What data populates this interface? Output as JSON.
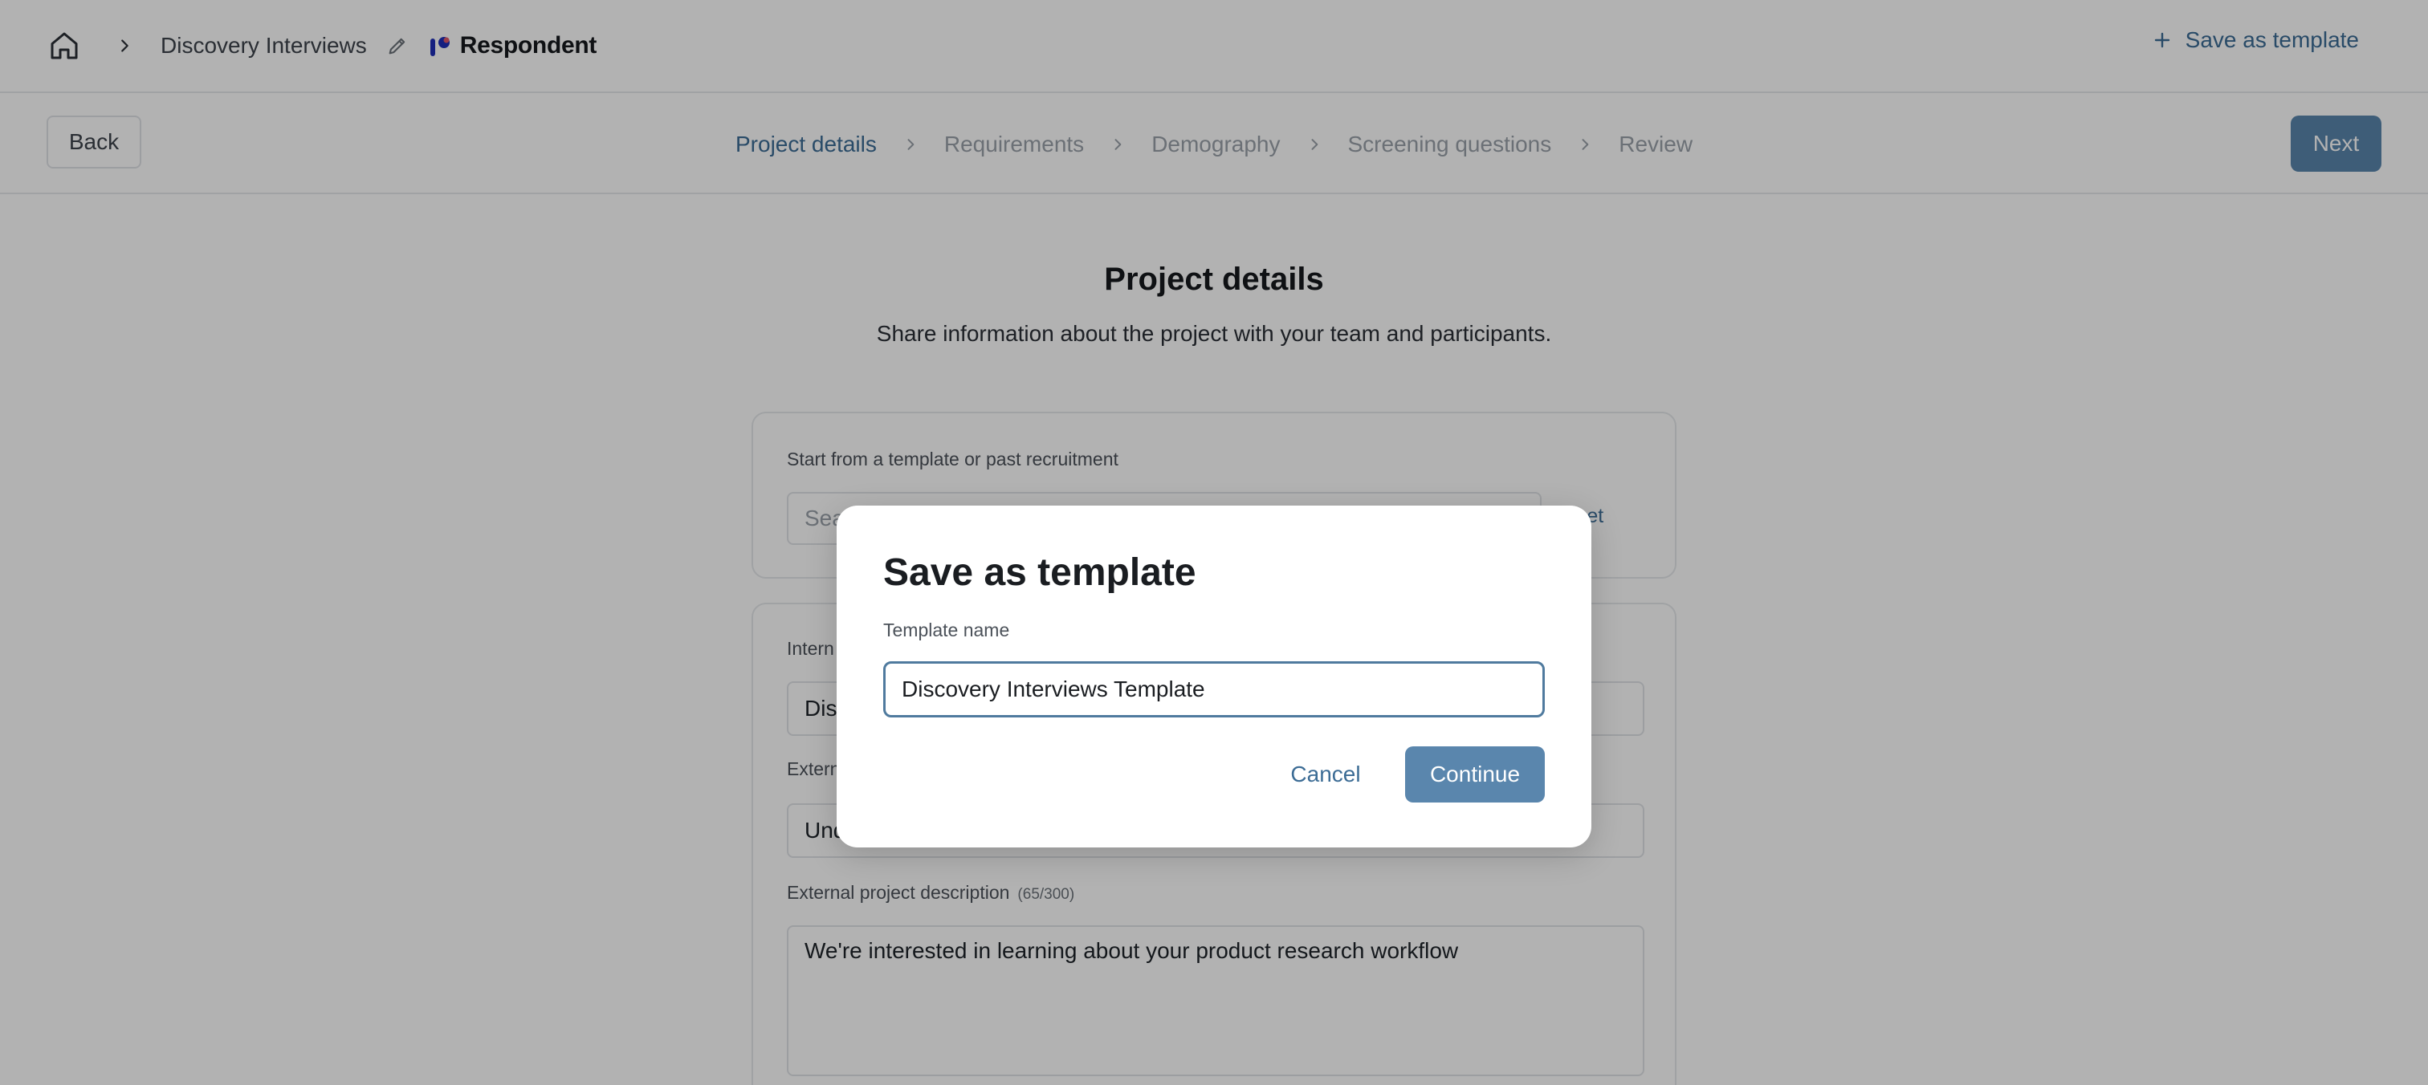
{
  "header": {
    "project_name": "Discovery Interviews",
    "brand_name": "Respondent",
    "save_template_label": "Save as template",
    "icons": {
      "home": "home-icon",
      "chevron": "chevron-right-icon",
      "edit": "pencil-icon",
      "plus": "plus-icon"
    },
    "brand_color": "#1f2fb8",
    "brand_accent_color": "#e05a6b"
  },
  "stepper": {
    "back_label": "Back",
    "next_label": "Next",
    "steps": [
      {
        "label": "Project details",
        "active": true
      },
      {
        "label": "Requirements",
        "active": false
      },
      {
        "label": "Demography",
        "active": false
      },
      {
        "label": "Screening questions",
        "active": false
      },
      {
        "label": "Review",
        "active": false
      }
    ]
  },
  "page": {
    "title": "Project details",
    "subtitle": "Share information about the project with your team and participants.",
    "template_section": {
      "label": "Start from a template or past recruitment",
      "search_placeholder_visible": "Sea",
      "reset_visible": "eset"
    },
    "fields": {
      "internal_label_visible": "Intern",
      "internal_value_visible": "Disc",
      "external_label_visible": "Extern",
      "external_value_visible": "Und",
      "description_label": "External project description",
      "description_count": "(65/300)",
      "description_value": "We're interested in learning about your product research workflow"
    }
  },
  "modal": {
    "title": "Save as template",
    "field_label": "Template name",
    "field_value": "Discovery Interviews Template",
    "cancel_label": "Cancel",
    "continue_label": "Continue"
  },
  "colors": {
    "accent": "#3c6c95",
    "primary_button": "#5a86ad",
    "overlay": "rgba(0,0,0,0.30)"
  }
}
